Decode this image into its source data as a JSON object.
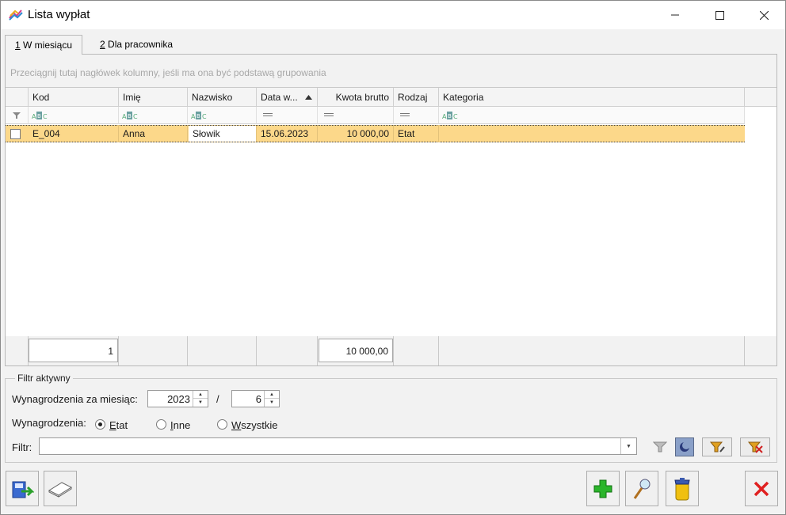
{
  "window": {
    "title": "Lista wypłat",
    "minimize_icon": "minimize-icon",
    "maximize_icon": "maximize-icon",
    "close_icon": "close-icon"
  },
  "tabs": [
    {
      "key": "1",
      "label": " W miesiącu",
      "active": true
    },
    {
      "key": "2",
      "label": " Dla pracownika",
      "active": false
    }
  ],
  "grid": {
    "group_hint": "Przeciągnij tutaj nagłówek kolumny, jeśli ma ona być podstawą grupowania",
    "columns": [
      "Kod",
      "Imię",
      "Nazwisko",
      "Data w...",
      "Kwota brutto",
      "Rodzaj",
      "Kategoria"
    ],
    "sort_column": "Data w...",
    "rows": [
      {
        "kod": "E_004",
        "imie": "Anna",
        "nazwisko": "Słowik",
        "data": "15.06.2023",
        "kwota": "10 000,00",
        "rodzaj": "Etat",
        "kategoria": ""
      }
    ],
    "footer": {
      "count": "1",
      "sum": "10 000,00"
    },
    "row_highlight_color": "#fcd88a"
  },
  "filter": {
    "group_label": "Filtr aktywny",
    "month_label": "Wynagrodzenia za miesiąc:",
    "year": "2023",
    "separator": "/",
    "month": "6",
    "type_label": "Wynagrodzenia:",
    "options": [
      {
        "label_first": "E",
        "label_rest": "tat",
        "selected": true
      },
      {
        "label_first": "I",
        "label_rest": "nne",
        "selected": false
      },
      {
        "label_first": "W",
        "label_rest": "szystkie",
        "selected": false
      }
    ],
    "filter_label": "Filtr:",
    "filter_value": ""
  },
  "toolbar": {
    "left": [
      "export-icon",
      "book-icon"
    ],
    "right": [
      "add-icon",
      "search-icon",
      "delete-icon",
      "close-red-icon"
    ]
  }
}
